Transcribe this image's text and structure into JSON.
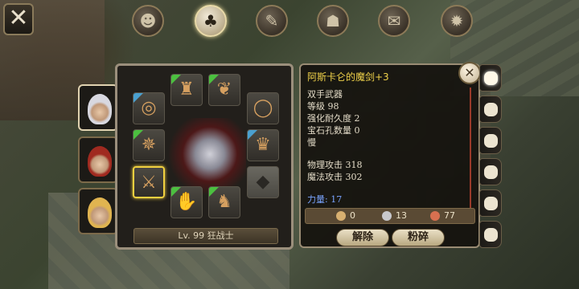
{
  "close_label": "✕",
  "top_tabs": [
    {
      "icon": "character-icon",
      "glyph": "☻",
      "active": false
    },
    {
      "icon": "bag-icon",
      "glyph": "♣",
      "active": true
    },
    {
      "icon": "skill-leaf-icon",
      "glyph": "✎",
      "active": false
    },
    {
      "icon": "party-icon",
      "glyph": "☗",
      "active": false
    },
    {
      "icon": "quest-scroll-icon",
      "glyph": "✉",
      "active": false
    },
    {
      "icon": "settings-gear-icon",
      "glyph": "✹",
      "active": false
    }
  ],
  "portraits": [
    {
      "name": "portrait-white-hair-hero",
      "color": "#d8d8e0",
      "active": true
    },
    {
      "name": "portrait-red-hair-hero",
      "color": "#a02a20",
      "active": false
    },
    {
      "name": "portrait-blonde-hero",
      "color": "#e0b450",
      "active": false
    }
  ],
  "equipment_slots": [
    {
      "name": "ring-slot",
      "glyph": "◎",
      "corner": "#4aa0d0"
    },
    {
      "name": "helmet-slot",
      "glyph": "♜",
      "corner": "#4cc040"
    },
    {
      "name": "necklace-slot",
      "glyph": "❦",
      "corner": "#4cc040"
    },
    {
      "name": "ring2-slot",
      "glyph": "◯",
      "corner": ""
    },
    {
      "name": "armor-slot",
      "glyph": "✵",
      "corner": "#4cc040"
    },
    {
      "name": "cloak-slot",
      "glyph": "♛",
      "corner": "#4aa0d0"
    },
    {
      "name": "weapon-slot",
      "glyph": "⚔",
      "corner": "",
      "selected": true
    },
    {
      "name": "gloves-slot",
      "glyph": "✋",
      "corner": "#4cc040"
    },
    {
      "name": "boots-slot",
      "glyph": "♞",
      "corner": "#4cc040"
    },
    {
      "name": "offhand-slot",
      "glyph": "◆",
      "corner": "",
      "empty": true
    }
  ],
  "level_text": "Lv. 99 狂战士",
  "item": {
    "name": "阿斯卡仑的魔剑+3",
    "type": "双手武器",
    "level": "等级 98",
    "durability": "强化耐久度 2",
    "gems": "宝石孔数量 0",
    "speed": "慢",
    "phys_attack": "物理攻击 318",
    "magic_attack": "魔法攻击 302",
    "strength": "力量: 17"
  },
  "currency": {
    "gold": "0",
    "silver": "13",
    "copper": "77",
    "colors": {
      "gold": "#d8b070",
      "silver": "#c8c8cc",
      "copper": "#d87050"
    }
  },
  "buttons": {
    "unequip": "解除",
    "smash": "粉碎"
  },
  "detail_close": "✕",
  "side_tabs": 6
}
